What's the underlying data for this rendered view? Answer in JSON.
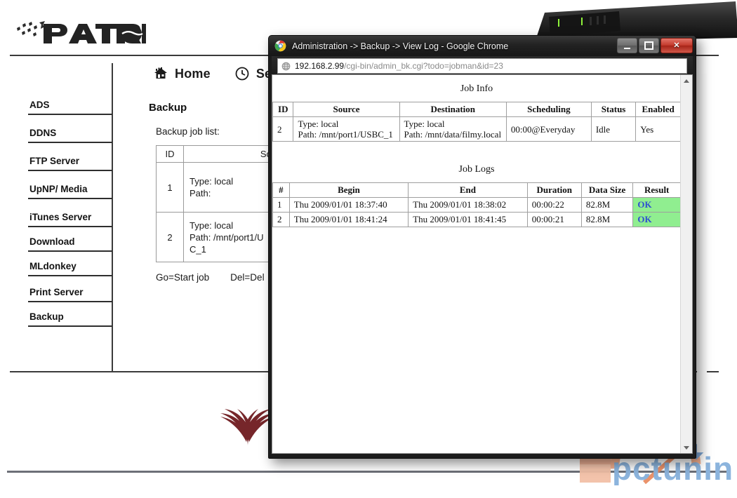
{
  "background": {
    "brand": "PATRIOT",
    "topnav": [
      {
        "label": "Home",
        "icon": "house-icon"
      },
      {
        "label": "Set",
        "icon": "clock-icon"
      }
    ],
    "sidebar": {
      "items": [
        {
          "label": "ADS"
        },
        {
          "label": "DDNS"
        },
        {
          "label": "FTP Server"
        },
        {
          "label": "UpNP/ Media"
        },
        {
          "label": "iTunes Server"
        },
        {
          "label": "Download"
        },
        {
          "label": "MLdonkey"
        },
        {
          "label": "Print Server"
        },
        {
          "label": "Backup"
        }
      ]
    },
    "content": {
      "title": "Backup",
      "subtitle": "Backup job list:",
      "table": {
        "headers": [
          "ID",
          "Source"
        ],
        "rows": [
          {
            "id": "1",
            "source_line1": "Type: local",
            "source_line2": "Path:",
            "source_line3": ""
          },
          {
            "id": "2",
            "source_line1": "Type: local",
            "source_line2": "Path: /mnt/port1/U",
            "source_line3": "C_1"
          }
        ]
      },
      "legend": [
        "Go=Start job",
        "Del=Del"
      ]
    },
    "watermark": {
      "text": "pctuning"
    }
  },
  "window": {
    "title": "Administration -> Backup -> View Log - Google Chrome",
    "icon": "chrome-icon",
    "controls": {
      "minimize": "minimize-button",
      "maximize": "maximize-button",
      "close": "close-button"
    },
    "omnibox": {
      "host": "192.168.2.99",
      "path": "/cgi-bin/admin_bk.cgi?todo=jobman&id=23",
      "icon": "globe-icon"
    },
    "page": {
      "job_info": {
        "title": "Job Info",
        "headers": [
          "ID",
          "Source",
          "Destination",
          "Scheduling",
          "Status",
          "Enabled"
        ],
        "rows": [
          {
            "id": "2",
            "source_line1": "Type: local",
            "source_line2": "Path: /mnt/port1/USBC_1",
            "dest_line1": "Type: local",
            "dest_line2": "Path: /mnt/data/filmy.local",
            "scheduling": "00:00@Everyday",
            "status": "Idle",
            "enabled": "Yes"
          }
        ]
      },
      "job_logs": {
        "title": "Job Logs",
        "headers": [
          "#",
          "Begin",
          "End",
          "Duration",
          "Data Size",
          "Result"
        ],
        "rows": [
          {
            "num": "1",
            "begin": "Thu 2009/01/01 18:37:40",
            "end": "Thu 2009/01/01 18:38:02",
            "duration": "00:00:22",
            "data_size": "82.8M",
            "result": "OK"
          },
          {
            "num": "2",
            "begin": "Thu 2009/01/01 18:41:24",
            "end": "Thu 2009/01/01 18:41:45",
            "duration": "00:00:21",
            "data_size": "82.8M",
            "result": "OK"
          }
        ]
      }
    },
    "colors": {
      "ok_background": "#90ee90",
      "ok_text": "#2f4fd0",
      "close_button": "#c33a2c"
    }
  }
}
